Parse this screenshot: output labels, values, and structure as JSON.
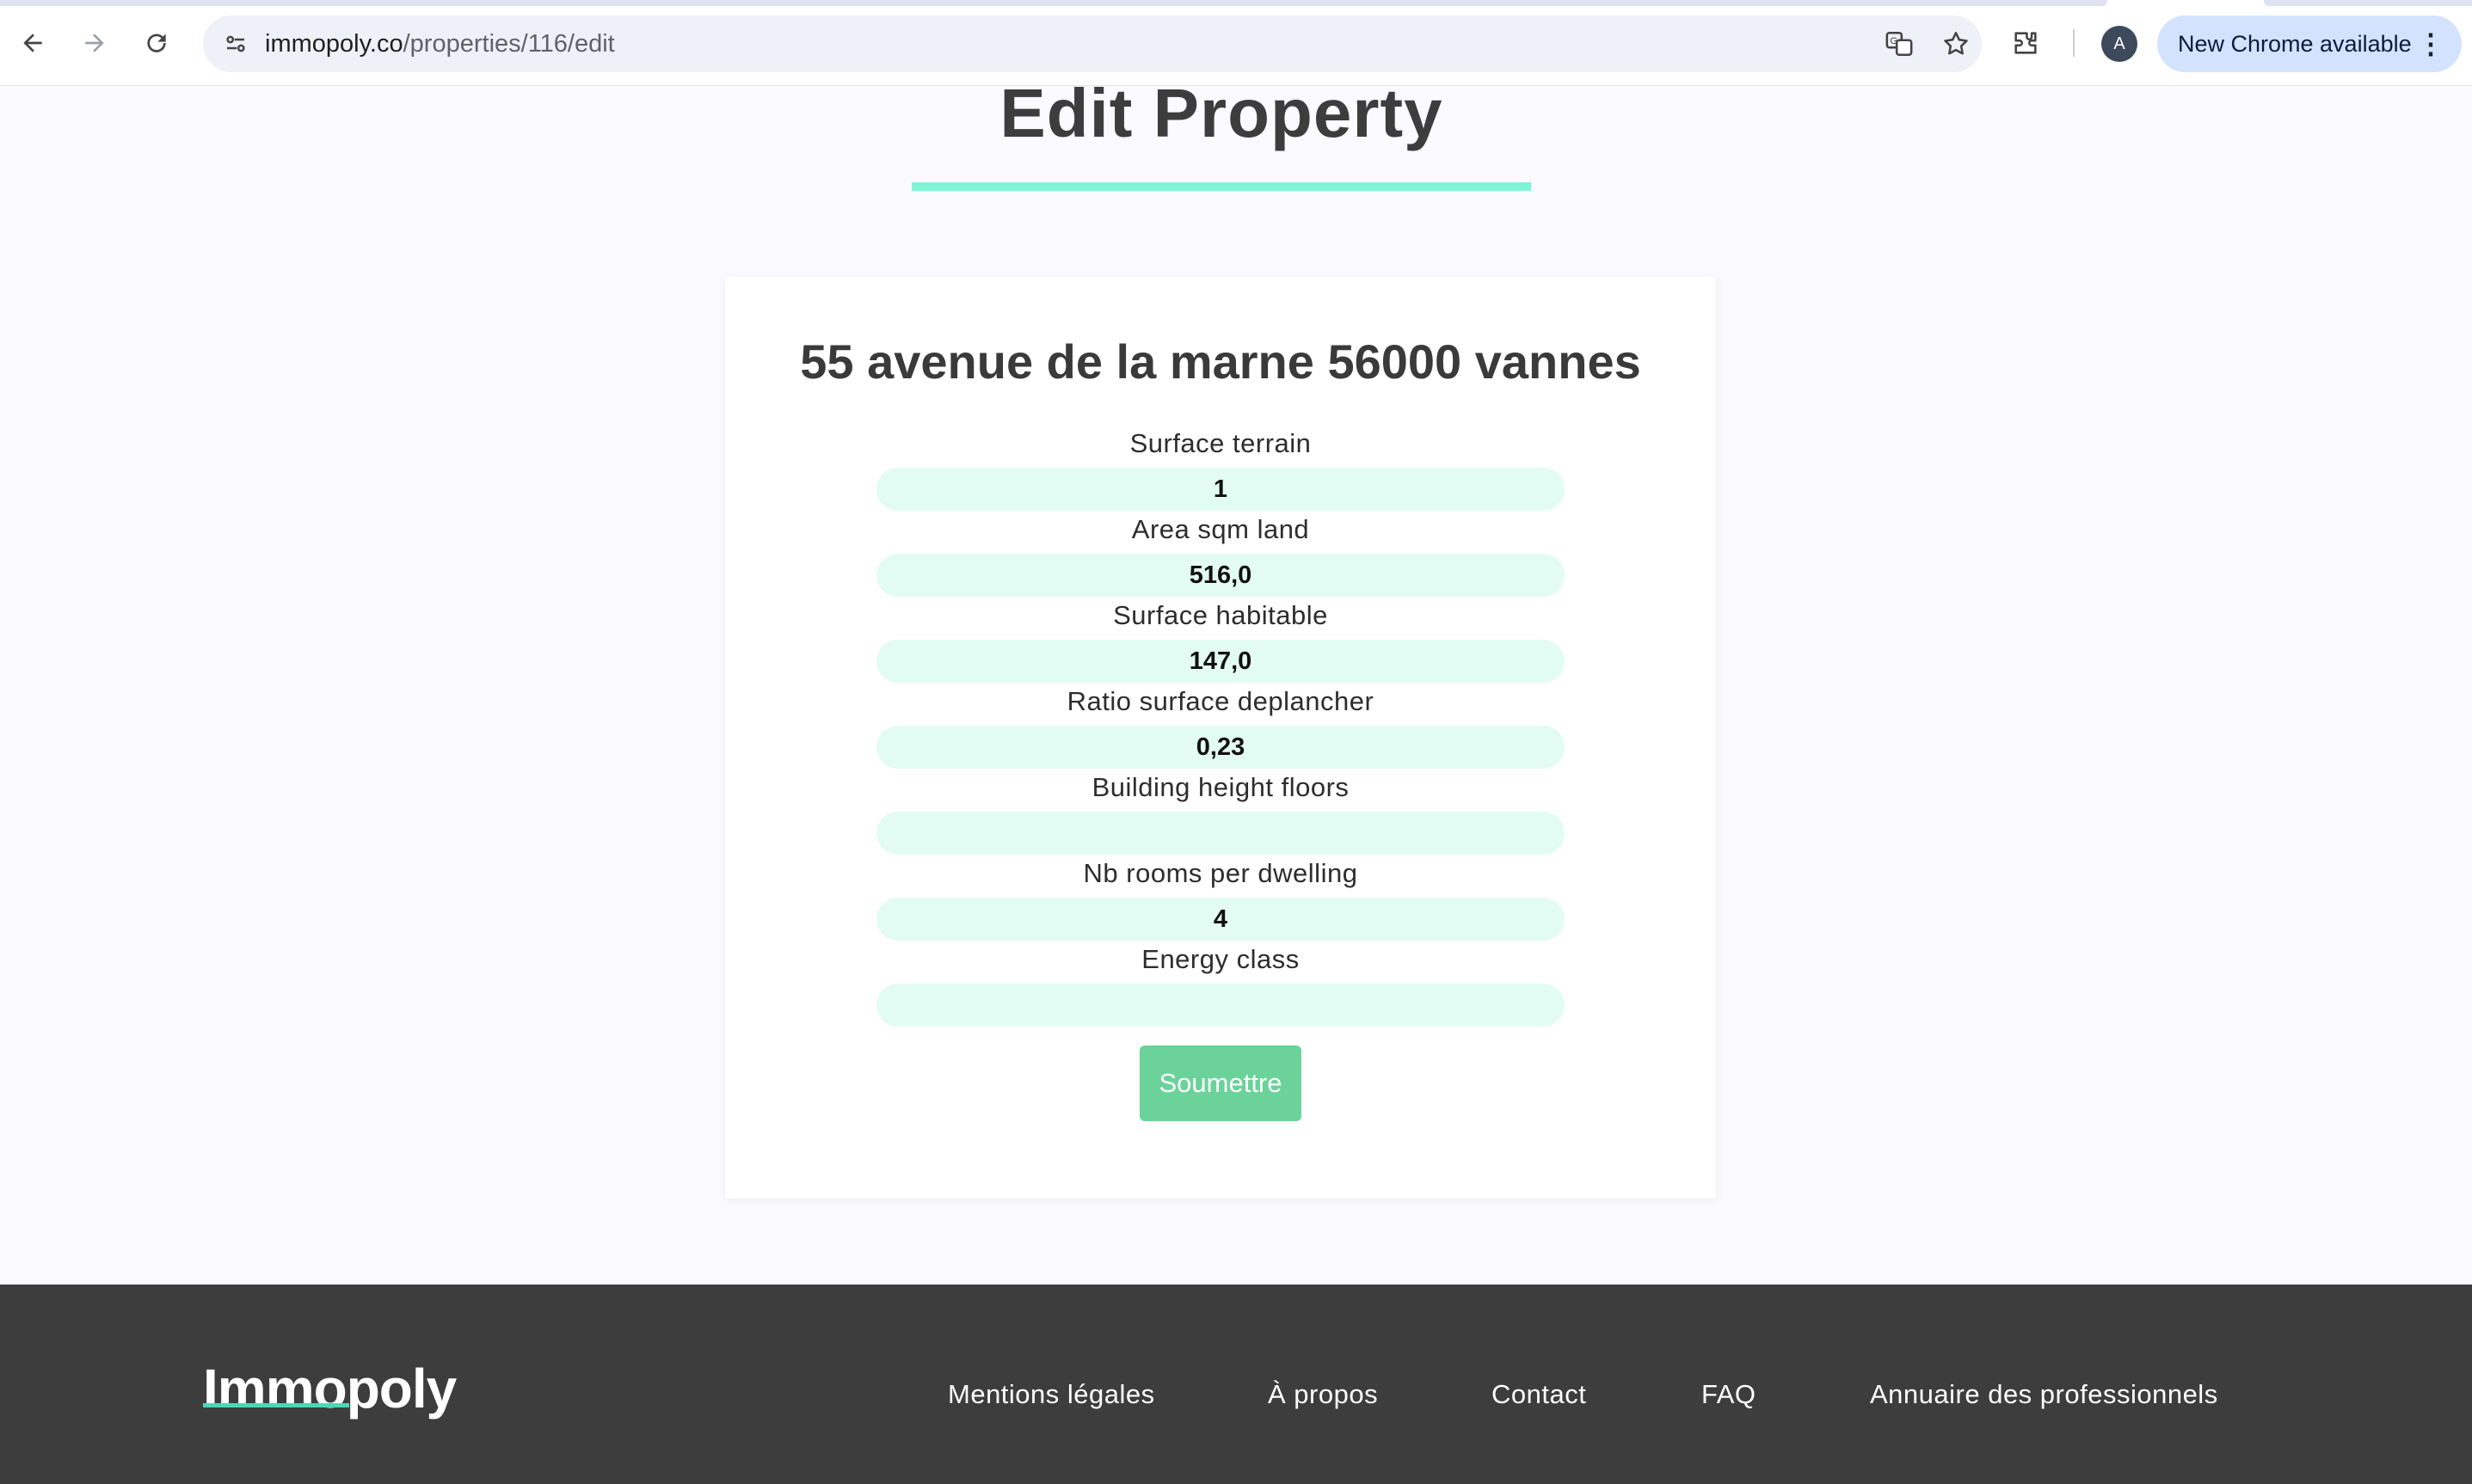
{
  "browser": {
    "url_host": "immopoly.co",
    "url_path": "/properties/116/edit",
    "avatar_letter": "A",
    "update_label": "New Chrome available",
    "menu_glyph": "⋮",
    "icons": [
      "back-arrow-icon",
      "forward-arrow-icon",
      "reload-icon",
      "site-info-icon",
      "translate-icon",
      "star-icon",
      "extensions-icon",
      "more-vert-icon"
    ]
  },
  "page": {
    "title": "Edit Property",
    "accent_color": "#7ef5d6"
  },
  "form": {
    "address": "55 avenue de la marne 56000 vannes",
    "fields": [
      {
        "label": "Surface terrain",
        "value": "1"
      },
      {
        "label": "Area sqm land",
        "value": "516,0"
      },
      {
        "label": "Surface habitable",
        "value": "147,0"
      },
      {
        "label": "Ratio surface deplancher",
        "value": "0,23"
      },
      {
        "label": "Building height floors",
        "value": ""
      },
      {
        "label": "Nb rooms per dwelling",
        "value": "4"
      },
      {
        "label": "Energy class",
        "value": ""
      }
    ],
    "submit_label": "Soumettre",
    "submit_color": "#6bd29a",
    "input_bg_color": "#e3fcf3"
  },
  "footer": {
    "logo": "Immopoly",
    "links": [
      "Mentions légales",
      "À propos",
      "Contact",
      "FAQ",
      "Annuaire des professionnels"
    ],
    "bg_color": "#3d3d3d"
  }
}
